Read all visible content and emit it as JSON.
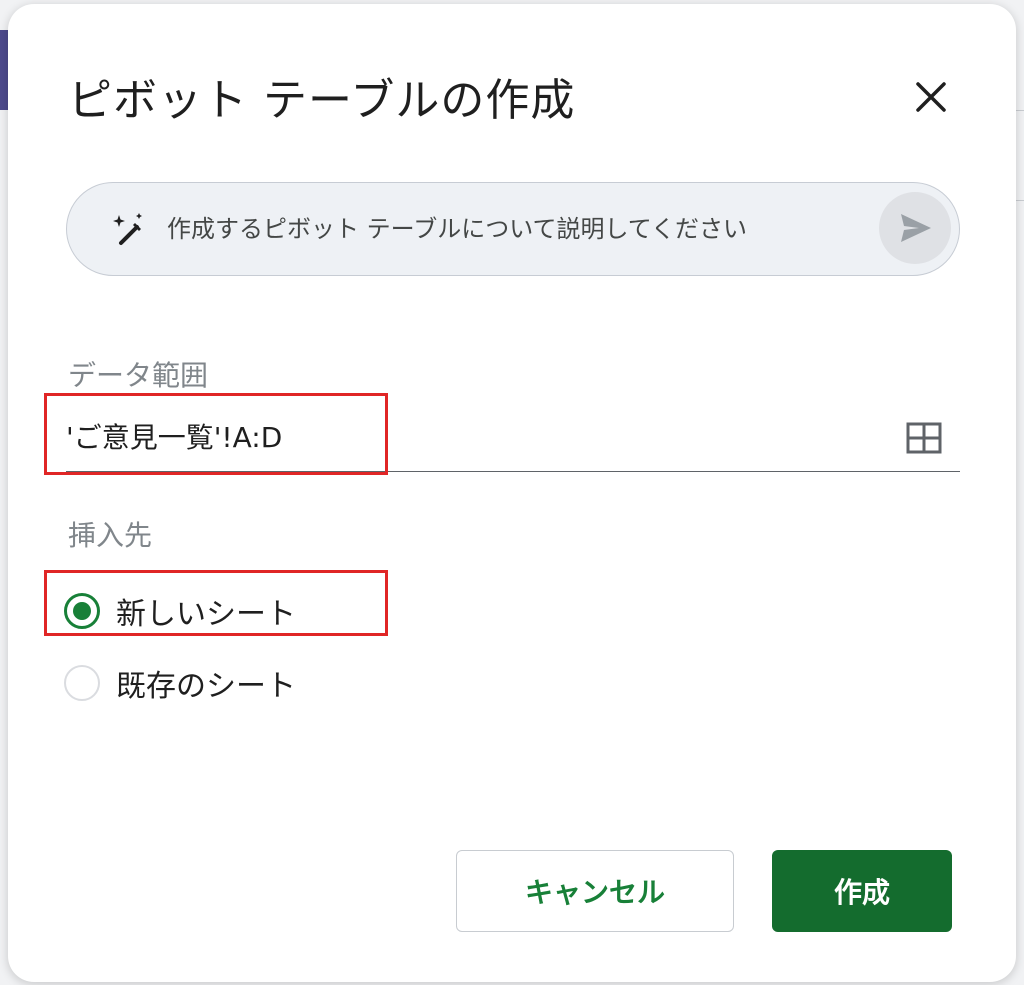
{
  "dialog": {
    "title": "ピボット テーブルの作成"
  },
  "ai_prompt": {
    "placeholder": "作成するピボット テーブルについて説明してください"
  },
  "data_range": {
    "label": "データ範囲",
    "value": "'ご意見一覧'!A:D"
  },
  "insert_location": {
    "label": "挿入先",
    "options": [
      {
        "label": "新しいシート",
        "selected": true
      },
      {
        "label": "既存のシート",
        "selected": false
      }
    ]
  },
  "buttons": {
    "cancel": "キャンセル",
    "create": "作成"
  },
  "colors": {
    "accent": "#188038",
    "primary_button": "#146c2e",
    "highlight": "#e02626"
  },
  "icons": [
    "close-icon",
    "sparkle-pen-icon",
    "send-icon",
    "grid-select-icon"
  ]
}
